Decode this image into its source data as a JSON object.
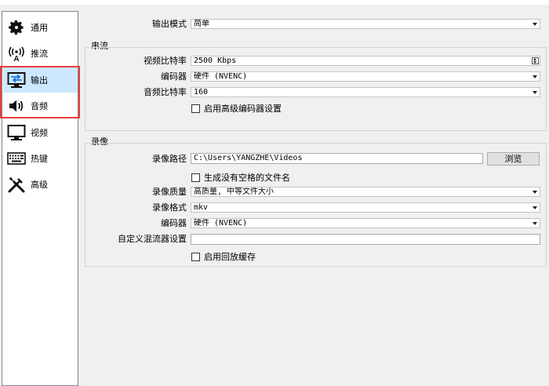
{
  "sidebar": {
    "items": [
      {
        "label": "通用",
        "icon": "gear-icon"
      },
      {
        "label": "推流",
        "icon": "broadcast-icon"
      },
      {
        "label": "输出",
        "icon": "output-icon"
      },
      {
        "label": "音频",
        "icon": "speaker-icon"
      },
      {
        "label": "视频",
        "icon": "monitor-icon"
      },
      {
        "label": "热键",
        "icon": "keyboard-icon"
      },
      {
        "label": "高级",
        "icon": "tools-icon"
      }
    ],
    "selected_index": 2
  },
  "output_mode": {
    "label": "输出模式",
    "value": "简单"
  },
  "streaming": {
    "title": "串流",
    "video_bitrate": {
      "label": "视频比特率",
      "value": "2500 Kbps"
    },
    "encoder": {
      "label": "编码器",
      "value": "硬件 (NVENC)"
    },
    "audio_bitrate": {
      "label": "音频比特率",
      "value": "160"
    },
    "advanced_encoder": {
      "label": "启用高级编码器设置",
      "checked": false
    }
  },
  "recording": {
    "title": "录像",
    "path": {
      "label": "录像路径",
      "value": "C:\\Users\\YANGZHE\\Videos",
      "browse_label": "浏览"
    },
    "no_space": {
      "label": "生成没有空格的文件名",
      "checked": false
    },
    "quality": {
      "label": "录像质量",
      "value": "高质量, 中等文件大小"
    },
    "format": {
      "label": "录像格式",
      "value": "mkv"
    },
    "encoder": {
      "label": "编码器",
      "value": "硬件 (NVENC)"
    },
    "custom_muxer": {
      "label": "自定义混流器设置",
      "value": ""
    },
    "replay_buffer": {
      "label": "启用回放缓存",
      "checked": false
    }
  },
  "colors": {
    "selected_bg": "#cce8ff",
    "highlight_border": "#e83d3d"
  }
}
